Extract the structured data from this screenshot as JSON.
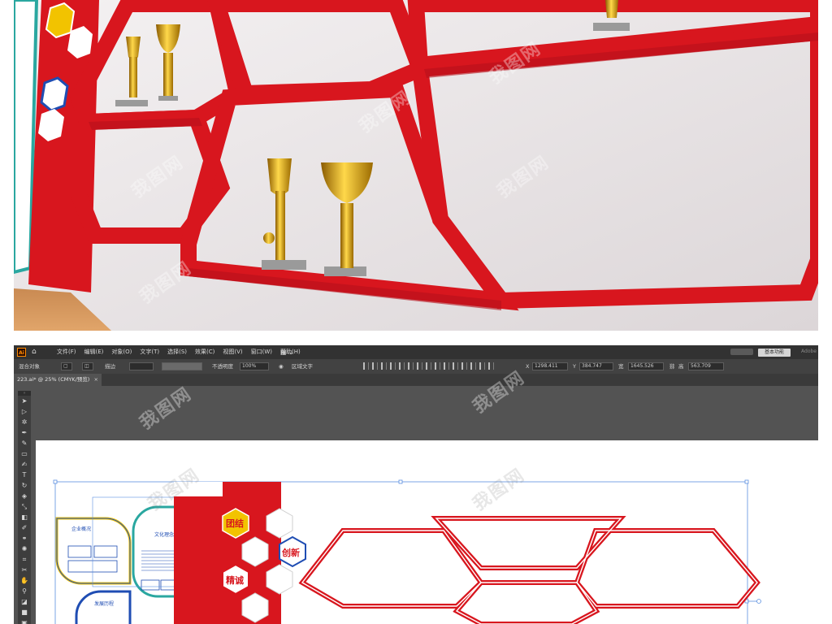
{
  "menubar": {
    "app_logo": "Ai",
    "items": [
      "文件(F)",
      "编辑(E)",
      "对象(O)",
      "文字(T)",
      "选择(S)",
      "效果(C)",
      "视图(V)",
      "窗口(W)",
      "帮助(H)"
    ],
    "right_tag": "基本功能",
    "right_text": "Adobe"
  },
  "ctrlbar": {
    "selection_label": "混合对象",
    "stroke_label": "描边",
    "opacity_label": "不透明度",
    "opacity_value": "100%",
    "region_text_label": "区域文字",
    "x_label": "X",
    "x_value": "1298.411",
    "y_label": "Y",
    "y_value": "384.747",
    "w_label": "宽",
    "w_value": "1645.526",
    "h_label": "高",
    "h_value": "563.709"
  },
  "document_tab": {
    "title": "223.ai* @ 25% (CMYK/预览)",
    "close": "×"
  },
  "artboard": {
    "labels": {
      "unity": "团结",
      "innovation": "创新",
      "excellence": "精诚",
      "company_overview": "企业概况",
      "culture_concept": "文化理念",
      "development": "发展历程"
    }
  },
  "colors": {
    "brand_red": "#d8161e",
    "ui_dark": "#535353",
    "hex_yellow": "#f2c300",
    "hex_blue": "#1f4db3",
    "teal": "#2aa7a0"
  },
  "watermark": "我图网"
}
